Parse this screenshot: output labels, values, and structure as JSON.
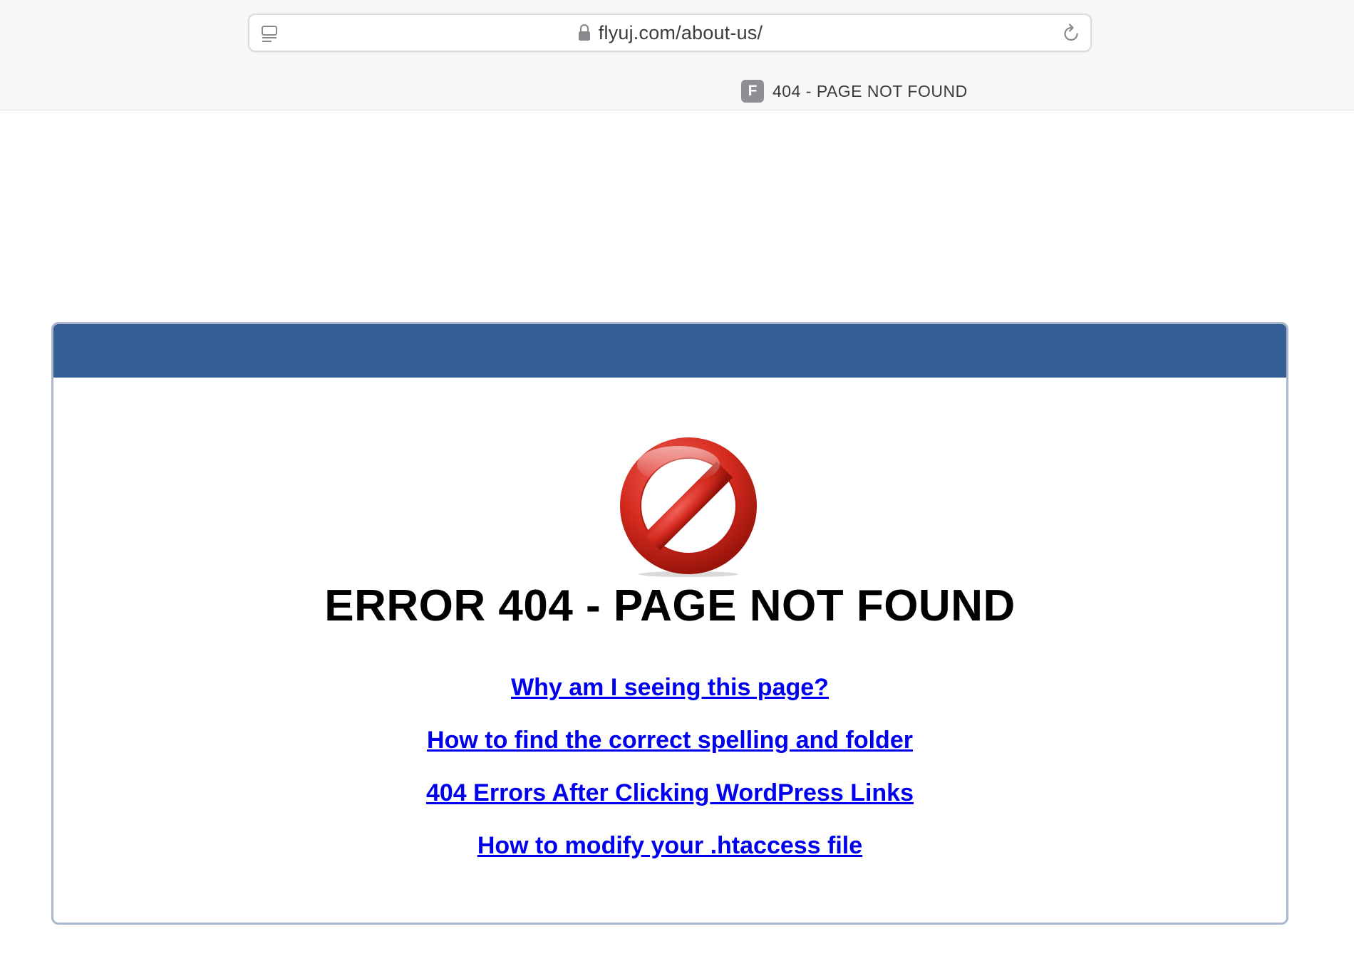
{
  "browser": {
    "url": "flyuj.com/about-us/",
    "tab": {
      "favicon_letter": "F",
      "title": "404 - PAGE NOT FOUND"
    },
    "icons": [
      "sidebar-icon",
      "lock-icon",
      "reload-icon"
    ]
  },
  "page": {
    "header_color": "#365e96",
    "error_icon": "no-entry-icon",
    "error_title": "ERROR 404 - PAGE NOT FOUND",
    "links": [
      "Why am I seeing this page?",
      "How to find the correct spelling and folder",
      "404 Errors After Clicking WordPress Links",
      "How to modify your .htaccess file"
    ],
    "link_color": "#0000ee"
  }
}
